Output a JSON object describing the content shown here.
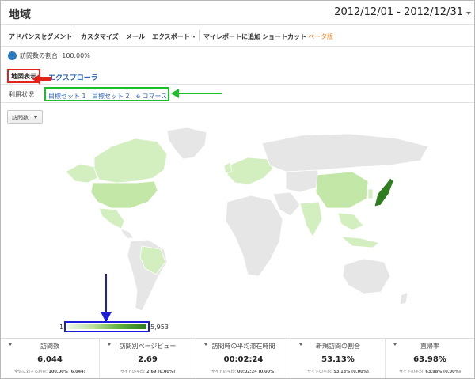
{
  "header": {
    "title": "地域",
    "date_range": "2012/12/01 - 2012/12/31"
  },
  "toolbar": {
    "items": [
      "アドバンスセグメント",
      "カスタマイズ",
      "メール",
      "エクスポート",
      "マイレポートに追加",
      "ショートカット"
    ],
    "beta_label": "ベータ版"
  },
  "segment": {
    "label": "訪問数の割合: 100.00%"
  },
  "view_tabs": {
    "map": "地図表示",
    "explorer": "エクスプローラ"
  },
  "usage": {
    "label": "利用状況",
    "goals": [
      "目標セット 1",
      "目標セット 2",
      "e コマース"
    ]
  },
  "metric_select": {
    "value": "訪問数"
  },
  "legend": {
    "min": "1",
    "max": "5,953"
  },
  "stats": [
    {
      "label": "訪問数",
      "value": "6,044",
      "sub_prefix": "全体に対する割合: ",
      "sub_value": "100.00% (6,044)"
    },
    {
      "label": "訪問別ページビュー",
      "value": "2.69",
      "sub_prefix": "サイトの平均: ",
      "sub_value": "2.69 (0.00%)"
    },
    {
      "label": "訪問時の平均滞在時間",
      "value": "00:02:24",
      "sub_prefix": "サイトの平均: ",
      "sub_value": "00:02:24 (0.00%)"
    },
    {
      "label": "新規訪問の割合",
      "value": "53.13%",
      "sub_prefix": "サイトの平均: ",
      "sub_value": "53.13% (0.00%)"
    },
    {
      "label": "直帰率",
      "value": "63.98%",
      "sub_prefix": "サイトの平均: ",
      "sub_value": "63.98% (0.00%)"
    }
  ],
  "colors": {
    "highlight_red": "#e2231a",
    "highlight_green": "#1bbf2a",
    "highlight_blue": "#1b1bdc",
    "map_top_region": "#2e7d1e",
    "map_light_region": "#d4efbf",
    "map_no_data": "#e6e6e6",
    "link": "#2a64b8"
  }
}
